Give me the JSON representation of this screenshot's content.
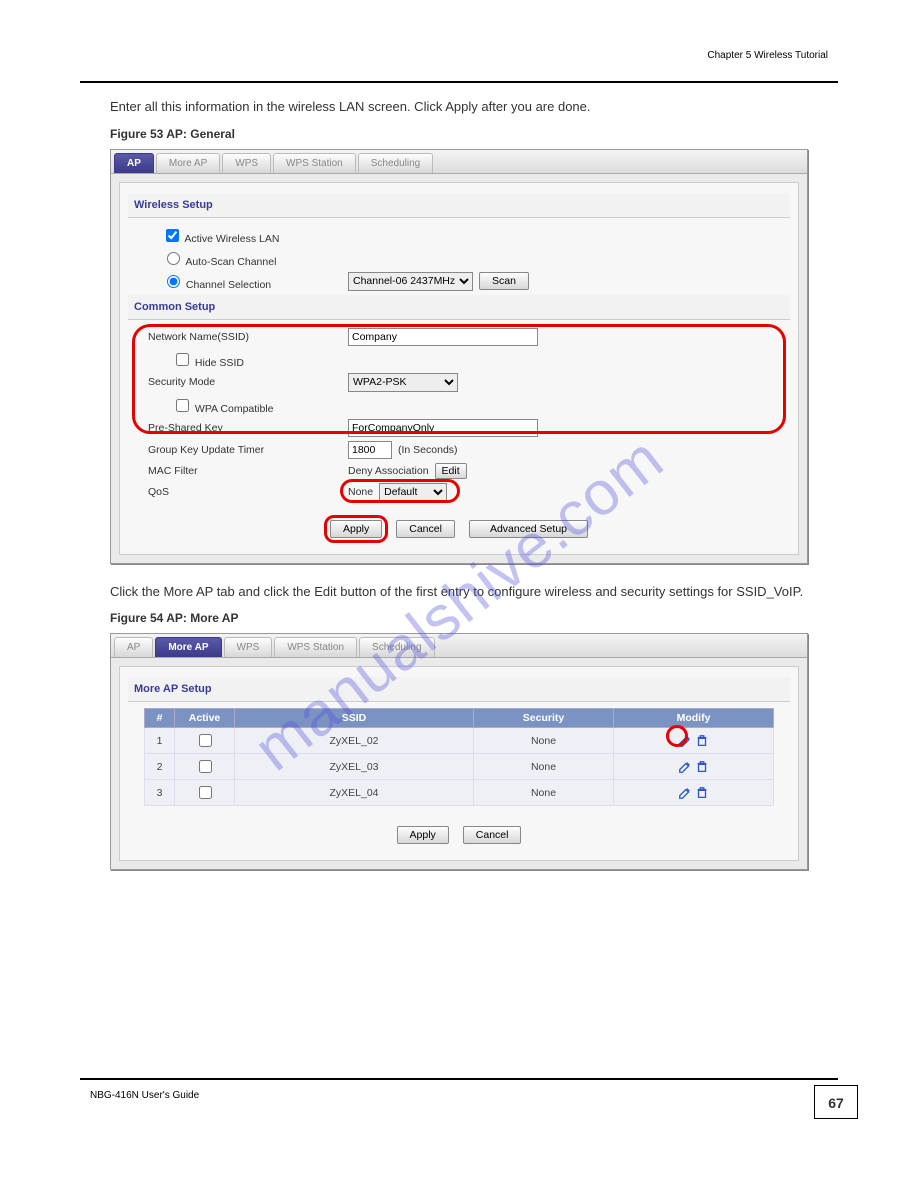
{
  "header_chapter": "Chapter 5 Wireless Tutorial",
  "intro_text": "Enter all this information in the wireless LAN screen. Click Apply after you are done.",
  "figure1_caption": "Figure 53   AP: General",
  "watermark": "manualshive.com",
  "panel1": {
    "tabs": [
      "AP",
      "More AP",
      "WPS",
      "WPS Station",
      "Scheduling"
    ],
    "active_tab": 0,
    "sections": {
      "wireless_setup_title": "Wireless Setup",
      "common_setup_title": "Common Setup"
    },
    "active_wlan_label": "Active Wireless LAN",
    "active_wlan_checked": true,
    "auto_scan_label": "Auto-Scan Channel",
    "channel_selection_label": "Channel Selection",
    "channel_sel_value": "Channel-06 2437MHz",
    "scan_btn": "Scan",
    "ssid_label": "Network Name(SSID)",
    "ssid_value": "Company",
    "hide_ssid_label": "Hide SSID",
    "security_mode_label": "Security Mode",
    "security_mode_value": "WPA2-PSK",
    "wpa_compat_label": "WPA Compatible",
    "psk_label": "Pre-Shared Key",
    "psk_value": "ForCompanyOnly",
    "group_key_label": "Group Key Update Timer",
    "group_key_value": "1800",
    "group_key_unit": "(In Seconds)",
    "mac_filter_label": "MAC Filter",
    "mac_filter_status": "Deny Association",
    "edit_btn": "Edit",
    "qos_label": "QoS",
    "qos_status": "None",
    "qos_select": "Default",
    "apply_btn": "Apply",
    "cancel_btn": "Cancel",
    "advanced_btn": "Advanced Setup"
  },
  "step2_text": "Click the More AP tab and click the Edit button of the first entry to configure wireless and security settings for SSID_VoIP.",
  "figure2_caption": "Figure 54   AP: More AP",
  "panel2": {
    "tabs": [
      "AP",
      "More AP",
      "WPS",
      "WPS Station",
      "Scheduling"
    ],
    "active_tab": 1,
    "section_title": "More AP Setup",
    "columns": [
      "#",
      "Active",
      "SSID",
      "Security",
      "Modify"
    ],
    "rows": [
      {
        "num": "1",
        "active": false,
        "ssid": "ZyXEL_02",
        "security": "None"
      },
      {
        "num": "2",
        "active": false,
        "ssid": "ZyXEL_03",
        "security": "None"
      },
      {
        "num": "3",
        "active": false,
        "ssid": "ZyXEL_04",
        "security": "None"
      }
    ],
    "apply_btn": "Apply",
    "cancel_btn": "Cancel"
  },
  "footer_left": "NBG-416N User's Guide",
  "page_number": "67"
}
